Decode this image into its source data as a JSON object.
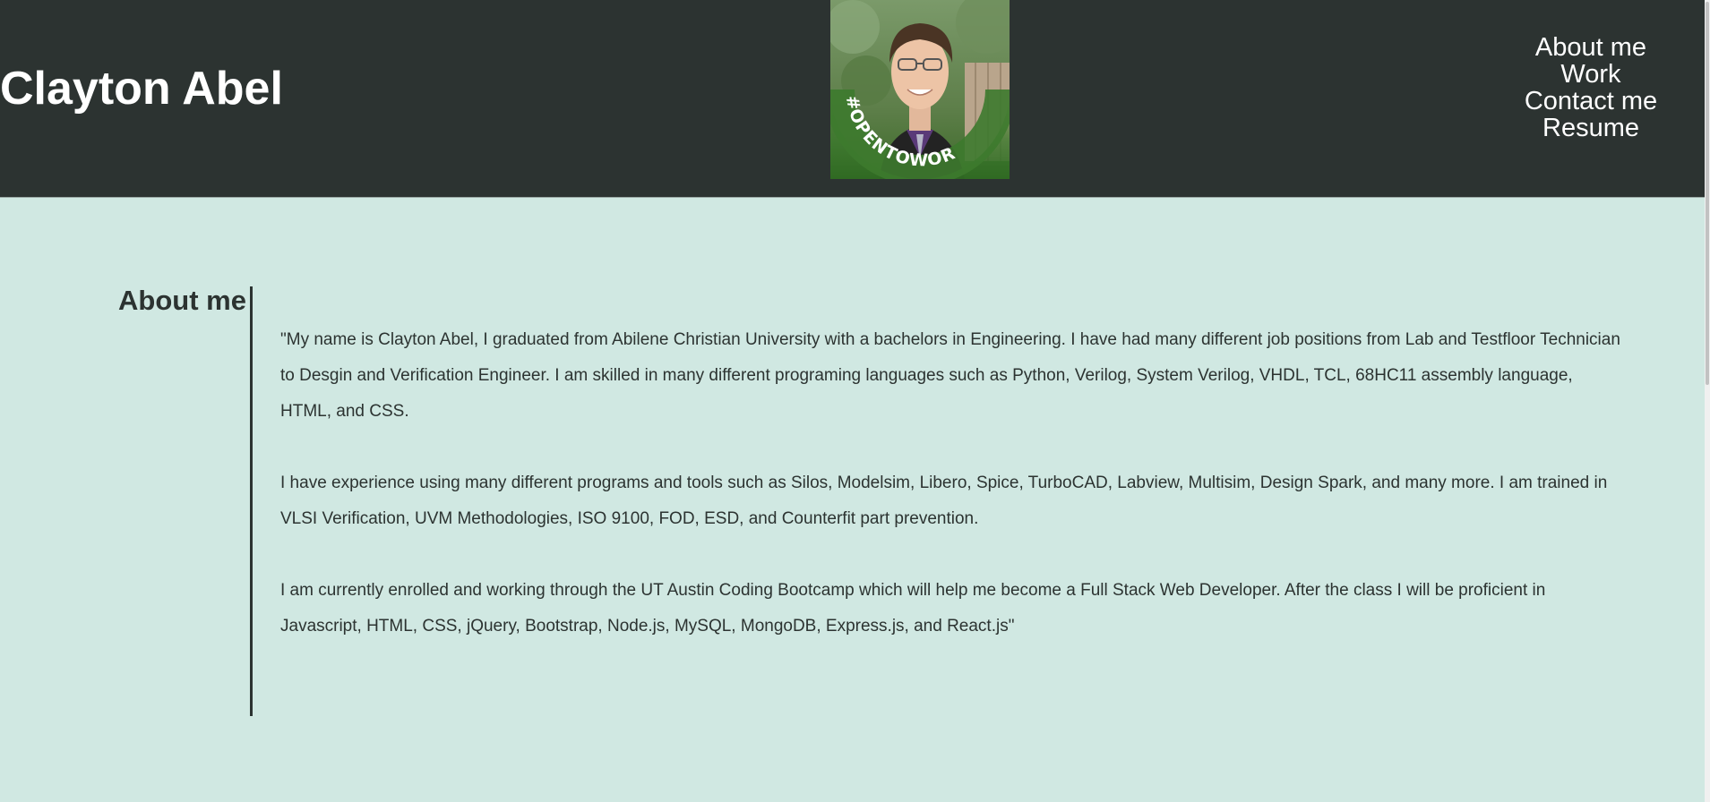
{
  "header": {
    "title": "Clayton Abel",
    "profile_badge_text": "#OPENTOWORK"
  },
  "nav": {
    "items": [
      {
        "label": "About me"
      },
      {
        "label": "Work"
      },
      {
        "label": "Contact me"
      },
      {
        "label": "Resume"
      }
    ]
  },
  "about": {
    "heading": "About me",
    "paragraphs": [
      "\"My name is Clayton Abel, I graduated from Abilene Christian University with a bachelors in Engineering. I have had many different job positions from Lab and Testfloor Technician to Desgin and Verification Engineer. I am skilled in many different programing languages such as Python, Verilog, System Verilog, VHDL, TCL, 68HC11 assembly language, HTML, and CSS.",
      "I have experience using many different programs and tools such as Silos, Modelsim, Libero, Spice, TurboCAD, Labview, Multisim, Design Spark, and many more. I am trained in VLSI Verification, UVM Methodologies, ISO 9100, FOD, ESD, and Counterfit part prevention.",
      "I am currently enrolled and working through the UT Austin Coding Bootcamp which will help me become a Full Stack Web Developer. After the class I will be proficient in Javascript, HTML, CSS, jQuery, Bootstrap, Node.js, MySQL, MongoDB, Express.js, and React.js\""
    ]
  },
  "colors": {
    "header_bg": "#2c3331",
    "page_bg": "#d0e8e2",
    "badge_green": "#3d7a2e",
    "text_dark": "#2c3331"
  }
}
